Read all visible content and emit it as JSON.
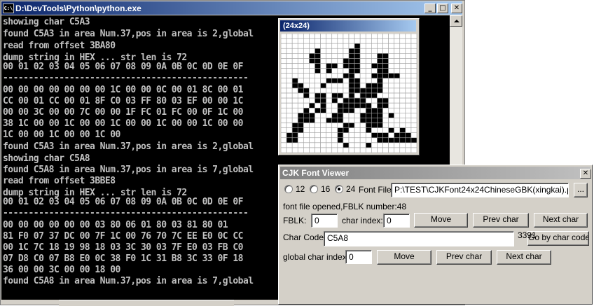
{
  "console": {
    "icon_text": "C:\\",
    "title": "D:\\DevTools\\Python\\python.exe",
    "buttons": {
      "minimize": "_",
      "maximize": "□",
      "close": "✕"
    },
    "lines": [
      "showing char C5A3",
      "found C5A3 in area Num.37,pos in area is 2,global",
      "read from offset 3BA80",
      "dump string in HEX ... str len is 72",
      "00 01 02 03 04 05 06 07 08 09 0A 0B 0C 0D 0E 0F",
      "------------------------------------------------",
      "00 00 00 00 00 00 00 1C 00 00 0C 00 01 8C 00 01",
      "CC 00 01 CC 00 01 8F C0 03 FF 80 03 EF 00 00 1C",
      "00 00 3C 00 00 7C 00 00 1F FC 01 FC 00 0F 1C 00",
      "38 1C 00 00 1C 00 00 1C 00 00 1C 00 00 1C 00 00",
      "1C 00 00 1C 00 00 1C 00",
      "found C5A3 in area Num.37,pos in area is 2,global",
      "showing char C5A8",
      "found C5A8 in area Num.37,pos in area is 7,global",
      "read from offset 3BBE8",
      "dump string in HEX ... str len is 72",
      "00 01 02 03 04 05 06 07 08 09 0A 0B 0C 0D 0E 0F",
      "------------------------------------------------",
      "00 00 00 00 00 00 03 80 06 01 80 03 81 80 01",
      "81 F0 07 37 DC 00 7F 1C 00 76 70 7C EE E0 0C CC",
      "00 1C 7C 18 19 98 18 03 3C 30 03 7F E0 03 FB C0",
      "07 D8 C0 07 B8 E0 0C 38 F0 1C 31 B8 3C 33 0F 18",
      "36 00 00 3C 00 00 18 00",
      "found C5A8 in area Num.37,pos in area is 7,global"
    ]
  },
  "glyph_window": {
    "title": "(24x24)",
    "width": 24,
    "height": 24,
    "rows": [
      "........................",
      "........................",
      ".............#..........",
      "......#.....##..........",
      ".....##.....##...##.....",
      ".....##....###...##.....",
      "......#.##.###..###.....",
      "......#.#...##...##.....",
      "...........##...#####...",
      "..#.....###.##...#......",
      "..##...#....##.###......",
      "...##.......######......",
      "....#.##.##.#.###.......",
      "......##.#.####..##.....",
      ".....#.#..######.##.....",
      "....#.##..###..###......",
      "...###...##...####.#....",
      "...###..###...####......",
      "..##.......##..###......",
      "..##......##...#...#.#..",
      ".##.......#.....###.###.",
      ".##.......#......#######",
      "...........#...#........",
      "........................"
    ]
  },
  "dialog": {
    "title": "CJK Font Viewer",
    "close": "✕",
    "size_options": [
      {
        "label": "12",
        "checked": false
      },
      {
        "label": "16",
        "checked": false
      },
      {
        "label": "24",
        "checked": true
      }
    ],
    "font_file_label": "Font File",
    "font_file_value": "P:\\TEST\\CJKFont24x24ChineseGBK(xingkai).pdb",
    "browse_label": "...",
    "status": "font file opened,FBLK number:48",
    "fblk_label": "FBLK:",
    "fblk_value": "0",
    "char_index_label": "char index:",
    "char_index_value": "0",
    "move_label": "Move",
    "prev_char_label": "Prev char",
    "next_char_label": "Next char",
    "char_code_label": "Char Code:",
    "char_code_value": "C5A8",
    "char_code_number": "3391",
    "go_by_code_label": "Go by char code",
    "global_index_label": "global char index:",
    "global_index_value": "0",
    "move2_label": "Move",
    "prev_char2_label": "Prev char",
    "next_char2_label": "Next char"
  }
}
